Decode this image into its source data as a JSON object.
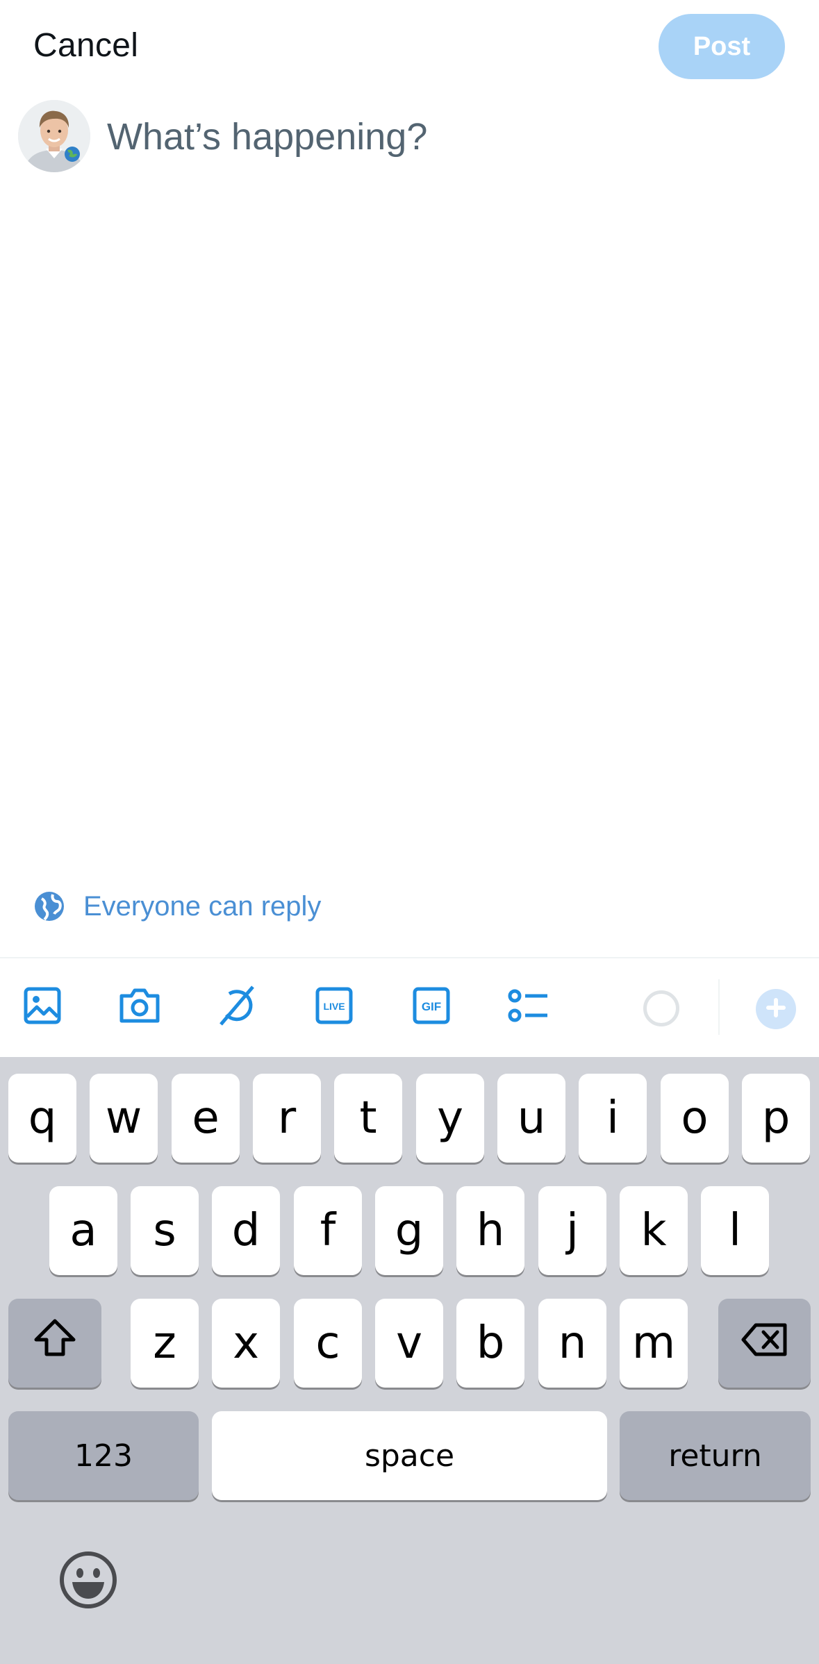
{
  "header": {
    "cancel_label": "Cancel",
    "post_label": "Post"
  },
  "composer": {
    "placeholder": "What’s happening?"
  },
  "reply_setting": {
    "label": "Everyone can reply"
  },
  "toolbar": {
    "icons": [
      "image-icon",
      "camera-icon",
      "grok-icon",
      "live-icon",
      "gif-icon",
      "poll-icon"
    ],
    "live_text": "LIVE",
    "gif_text": "GIF"
  },
  "keyboard": {
    "row1": [
      "q",
      "w",
      "e",
      "r",
      "t",
      "y",
      "u",
      "i",
      "o",
      "p"
    ],
    "row2": [
      "a",
      "s",
      "d",
      "f",
      "g",
      "h",
      "j",
      "k",
      "l"
    ],
    "row3": [
      "z",
      "x",
      "c",
      "v",
      "b",
      "n",
      "m"
    ],
    "numbers_label": "123",
    "space_label": "space",
    "return_label": "return"
  },
  "colors": {
    "accent": "#1d9bf0",
    "post_disabled": "#a9d3f7",
    "link_blue": "#4a8fd4",
    "keyboard_bg": "#d1d3d9"
  }
}
